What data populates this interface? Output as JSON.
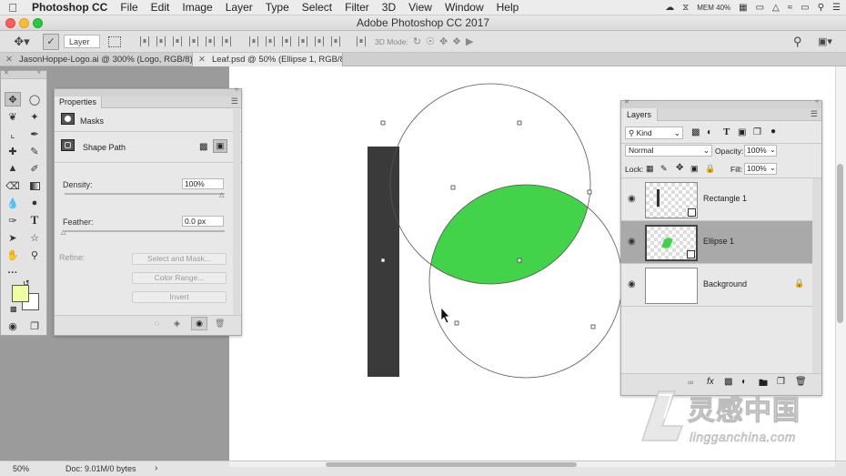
{
  "menubar": {
    "apple": "",
    "app_name": "Photoshop CC",
    "items": [
      "File",
      "Edit",
      "Image",
      "Layer",
      "Type",
      "Select",
      "Filter",
      "3D",
      "View",
      "Window",
      "Help"
    ],
    "status": [
      "MEM 40%"
    ]
  },
  "window": {
    "title": "Adobe Photoshop CC 2017"
  },
  "options": {
    "layer_select": "Layer",
    "mode_3d": "3D Mode:"
  },
  "tabs": [
    {
      "label": "JasonHoppe-Logo.ai @ 300% (Logo, RGB/8) *",
      "active": false
    },
    {
      "label": "Leaf.psd @ 50% (Ellipse 1, RGB/8) *",
      "active": true
    }
  ],
  "properties": {
    "tab": "Properties",
    "section": "Masks",
    "shape_path": "Shape Path",
    "density_label": "Density:",
    "density_value": "100%",
    "density_fraction": 1.0,
    "feather_label": "Feather:",
    "feather_value": "0.0 px",
    "feather_fraction": 0.0,
    "refine_label": "Refine:",
    "select_mask": "Select and Mask...",
    "color_range": "Color Range...",
    "invert": "Invert"
  },
  "layers": {
    "tab": "Layers",
    "kind": "Kind",
    "blend_mode": "Normal",
    "opacity_label": "Opacity:",
    "opacity_value": "100%",
    "lock_label": "Lock:",
    "fill_label": "Fill:",
    "fill_value": "100%",
    "items": [
      {
        "name": "Rectangle 1",
        "selected": false
      },
      {
        "name": "Ellipse 1",
        "selected": true
      },
      {
        "name": "Background",
        "selected": false
      }
    ]
  },
  "status": {
    "zoom": "50%",
    "doc": "Doc: 9.01M/0 bytes"
  },
  "colors": {
    "leaf_green": "#43d34a",
    "rect_dark": "#3a3a3a",
    "foreground": "#eefea3",
    "background": "#ffffff"
  },
  "watermark": {
    "cn": "灵感中国",
    "url": "lingganchina.com"
  }
}
